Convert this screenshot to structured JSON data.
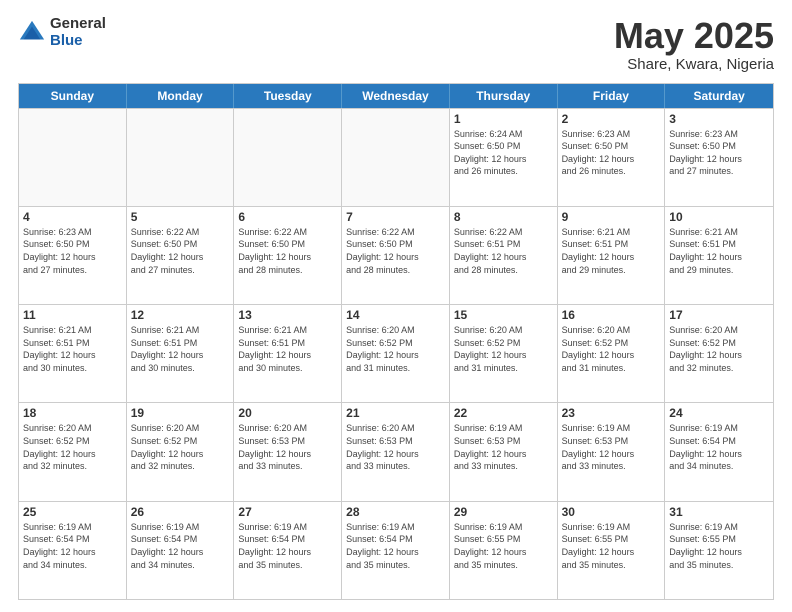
{
  "logo": {
    "general": "General",
    "blue": "Blue"
  },
  "title": {
    "month": "May 2025",
    "location": "Share, Kwara, Nigeria"
  },
  "weekdays": [
    "Sunday",
    "Monday",
    "Tuesday",
    "Wednesday",
    "Thursday",
    "Friday",
    "Saturday"
  ],
  "rows": [
    [
      {
        "day": "",
        "info": ""
      },
      {
        "day": "",
        "info": ""
      },
      {
        "day": "",
        "info": ""
      },
      {
        "day": "",
        "info": ""
      },
      {
        "day": "1",
        "info": "Sunrise: 6:24 AM\nSunset: 6:50 PM\nDaylight: 12 hours\nand 26 minutes."
      },
      {
        "day": "2",
        "info": "Sunrise: 6:23 AM\nSunset: 6:50 PM\nDaylight: 12 hours\nand 26 minutes."
      },
      {
        "day": "3",
        "info": "Sunrise: 6:23 AM\nSunset: 6:50 PM\nDaylight: 12 hours\nand 27 minutes."
      }
    ],
    [
      {
        "day": "4",
        "info": "Sunrise: 6:23 AM\nSunset: 6:50 PM\nDaylight: 12 hours\nand 27 minutes."
      },
      {
        "day": "5",
        "info": "Sunrise: 6:22 AM\nSunset: 6:50 PM\nDaylight: 12 hours\nand 27 minutes."
      },
      {
        "day": "6",
        "info": "Sunrise: 6:22 AM\nSunset: 6:50 PM\nDaylight: 12 hours\nand 28 minutes."
      },
      {
        "day": "7",
        "info": "Sunrise: 6:22 AM\nSunset: 6:50 PM\nDaylight: 12 hours\nand 28 minutes."
      },
      {
        "day": "8",
        "info": "Sunrise: 6:22 AM\nSunset: 6:51 PM\nDaylight: 12 hours\nand 28 minutes."
      },
      {
        "day": "9",
        "info": "Sunrise: 6:21 AM\nSunset: 6:51 PM\nDaylight: 12 hours\nand 29 minutes."
      },
      {
        "day": "10",
        "info": "Sunrise: 6:21 AM\nSunset: 6:51 PM\nDaylight: 12 hours\nand 29 minutes."
      }
    ],
    [
      {
        "day": "11",
        "info": "Sunrise: 6:21 AM\nSunset: 6:51 PM\nDaylight: 12 hours\nand 30 minutes."
      },
      {
        "day": "12",
        "info": "Sunrise: 6:21 AM\nSunset: 6:51 PM\nDaylight: 12 hours\nand 30 minutes."
      },
      {
        "day": "13",
        "info": "Sunrise: 6:21 AM\nSunset: 6:51 PM\nDaylight: 12 hours\nand 30 minutes."
      },
      {
        "day": "14",
        "info": "Sunrise: 6:20 AM\nSunset: 6:52 PM\nDaylight: 12 hours\nand 31 minutes."
      },
      {
        "day": "15",
        "info": "Sunrise: 6:20 AM\nSunset: 6:52 PM\nDaylight: 12 hours\nand 31 minutes."
      },
      {
        "day": "16",
        "info": "Sunrise: 6:20 AM\nSunset: 6:52 PM\nDaylight: 12 hours\nand 31 minutes."
      },
      {
        "day": "17",
        "info": "Sunrise: 6:20 AM\nSunset: 6:52 PM\nDaylight: 12 hours\nand 32 minutes."
      }
    ],
    [
      {
        "day": "18",
        "info": "Sunrise: 6:20 AM\nSunset: 6:52 PM\nDaylight: 12 hours\nand 32 minutes."
      },
      {
        "day": "19",
        "info": "Sunrise: 6:20 AM\nSunset: 6:52 PM\nDaylight: 12 hours\nand 32 minutes."
      },
      {
        "day": "20",
        "info": "Sunrise: 6:20 AM\nSunset: 6:53 PM\nDaylight: 12 hours\nand 33 minutes."
      },
      {
        "day": "21",
        "info": "Sunrise: 6:20 AM\nSunset: 6:53 PM\nDaylight: 12 hours\nand 33 minutes."
      },
      {
        "day": "22",
        "info": "Sunrise: 6:19 AM\nSunset: 6:53 PM\nDaylight: 12 hours\nand 33 minutes."
      },
      {
        "day": "23",
        "info": "Sunrise: 6:19 AM\nSunset: 6:53 PM\nDaylight: 12 hours\nand 33 minutes."
      },
      {
        "day": "24",
        "info": "Sunrise: 6:19 AM\nSunset: 6:54 PM\nDaylight: 12 hours\nand 34 minutes."
      }
    ],
    [
      {
        "day": "25",
        "info": "Sunrise: 6:19 AM\nSunset: 6:54 PM\nDaylight: 12 hours\nand 34 minutes."
      },
      {
        "day": "26",
        "info": "Sunrise: 6:19 AM\nSunset: 6:54 PM\nDaylight: 12 hours\nand 34 minutes."
      },
      {
        "day": "27",
        "info": "Sunrise: 6:19 AM\nSunset: 6:54 PM\nDaylight: 12 hours\nand 35 minutes."
      },
      {
        "day": "28",
        "info": "Sunrise: 6:19 AM\nSunset: 6:54 PM\nDaylight: 12 hours\nand 35 minutes."
      },
      {
        "day": "29",
        "info": "Sunrise: 6:19 AM\nSunset: 6:55 PM\nDaylight: 12 hours\nand 35 minutes."
      },
      {
        "day": "30",
        "info": "Sunrise: 6:19 AM\nSunset: 6:55 PM\nDaylight: 12 hours\nand 35 minutes."
      },
      {
        "day": "31",
        "info": "Sunrise: 6:19 AM\nSunset: 6:55 PM\nDaylight: 12 hours\nand 35 minutes."
      }
    ]
  ]
}
